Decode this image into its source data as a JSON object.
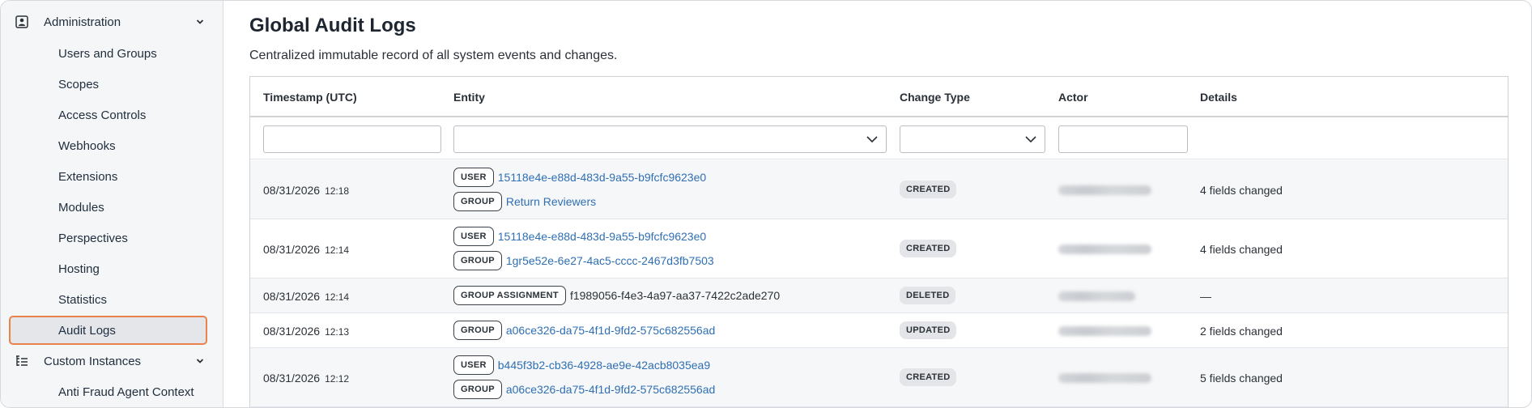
{
  "sidebar": {
    "section1": {
      "label": "Administration",
      "icon": "admin-person-icon"
    },
    "items": [
      {
        "label": "Users and Groups"
      },
      {
        "label": "Scopes"
      },
      {
        "label": "Access Controls"
      },
      {
        "label": "Webhooks"
      },
      {
        "label": "Extensions"
      },
      {
        "label": "Modules"
      },
      {
        "label": "Perspectives"
      },
      {
        "label": "Hosting"
      },
      {
        "label": "Statistics"
      },
      {
        "label": "Audit Logs",
        "active": true
      }
    ],
    "section2": {
      "label": "Custom Instances",
      "icon": "hierarchy-list-icon"
    },
    "items2": [
      {
        "label": "Anti Fraud Agent Context"
      }
    ],
    "active_color": "#e8844a"
  },
  "page": {
    "title": "Global Audit Logs",
    "subtitle": "Centralized immutable record of all system events and changes."
  },
  "table": {
    "columns": {
      "timestamp": "Timestamp (UTC)",
      "entity": "Entity",
      "change_type": "Change Type",
      "actor": "Actor",
      "details": "Details"
    },
    "filters": {
      "timestamp": "",
      "entity": "",
      "change_type": "",
      "actor": ""
    },
    "rows": [
      {
        "date": "08/31/2026",
        "time": "12:18",
        "entities": [
          {
            "tag": "USER",
            "text": "15118e4e-e88d-483d-9a55-b9fcfc9623e0",
            "link": true
          },
          {
            "tag": "GROUP",
            "text": "Return Reviewers",
            "link": true
          }
        ],
        "change": "CREATED",
        "details": "4 fields changed"
      },
      {
        "date": "08/31/2026",
        "time": "12:14",
        "entities": [
          {
            "tag": "USER",
            "text": "15118e4e-e88d-483d-9a55-b9fcfc9623e0",
            "link": true
          },
          {
            "tag": "GROUP",
            "text": "1gr5e52e-6e27-4ac5-cccc-2467d3fb7503",
            "link": true
          }
        ],
        "change": "CREATED",
        "details": "4 fields changed"
      },
      {
        "date": "08/31/2026",
        "time": "12:14",
        "entities": [
          {
            "tag": "GROUP ASSIGNMENT",
            "text": "f1989056-f4e3-4a97-aa37-7422c2ade270",
            "link": false
          }
        ],
        "change": "DELETED",
        "details": "—"
      },
      {
        "date": "08/31/2026",
        "time": "12:13",
        "entities": [
          {
            "tag": "GROUP",
            "text": "a06ce326-da75-4f1d-9fd2-575c682556ad",
            "link": true
          }
        ],
        "change": "UPDATED",
        "details": "2 fields changed"
      },
      {
        "date": "08/31/2026",
        "time": "12:12",
        "entities": [
          {
            "tag": "USER",
            "text": "b445f3b2-cb36-4928-ae9e-42acb8035ea9",
            "link": true
          },
          {
            "tag": "GROUP",
            "text": "a06ce326-da75-4f1d-9fd2-575c682556ad",
            "link": true
          }
        ],
        "change": "CREATED",
        "details": "5 fields changed"
      }
    ]
  },
  "colors": {
    "link": "#2f6fb4",
    "badge_bg": "#e3e5e8",
    "sidebar_bg": "#f5f6f7"
  }
}
